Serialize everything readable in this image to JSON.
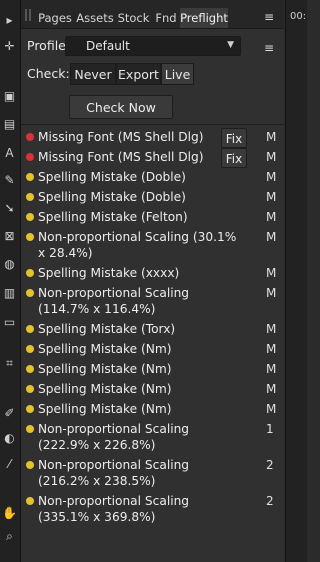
{
  "tabs": [
    "Pages",
    "Assets",
    "Stock",
    "Fnd",
    "Preflight"
  ],
  "active_tab": "Preflight",
  "right_edge_text": "00:",
  "profile": {
    "label": "Profile:",
    "value": "Default"
  },
  "check": {
    "label": "Check:",
    "options": [
      "Never",
      "Export",
      "Live"
    ],
    "selected": "Live"
  },
  "check_now_label": "Check Now",
  "fix_label": "Fix",
  "colors": {
    "error": "#d9313a",
    "warning": "#e6c22b"
  },
  "issues": [
    {
      "severity": "error",
      "text": "Missing Font (MS Shell Dlg)",
      "fix": true,
      "col": "M"
    },
    {
      "severity": "error",
      "text": "Missing Font (MS Shell Dlg)",
      "fix": true,
      "col": "M"
    },
    {
      "severity": "warning",
      "text": "Spelling Mistake (Doble)",
      "fix": false,
      "col": "M"
    },
    {
      "severity": "warning",
      "text": "Spelling Mistake (Doble)",
      "fix": false,
      "col": "M"
    },
    {
      "severity": "warning",
      "text": "Spelling Mistake (Felton)",
      "fix": false,
      "col": "M"
    },
    {
      "severity": "warning",
      "text": "Non-proportional Scaling (30.1% x 28.4%)",
      "fix": false,
      "col": "M"
    },
    {
      "severity": "warning",
      "text": "Spelling Mistake (xxxx)",
      "fix": false,
      "col": "M"
    },
    {
      "severity": "warning",
      "text": "Non-proportional Scaling (114.7% x 116.4%)",
      "fix": false,
      "col": "M"
    },
    {
      "severity": "warning",
      "text": "Spelling Mistake (Torx)",
      "fix": false,
      "col": "M"
    },
    {
      "severity": "warning",
      "text": "Spelling Mistake (Nm)",
      "fix": false,
      "col": "M"
    },
    {
      "severity": "warning",
      "text": "Spelling Mistake (Nm)",
      "fix": false,
      "col": "M"
    },
    {
      "severity": "warning",
      "text": "Spelling Mistake (Nm)",
      "fix": false,
      "col": "M"
    },
    {
      "severity": "warning",
      "text": "Spelling Mistake (Nm)",
      "fix": false,
      "col": "M"
    },
    {
      "severity": "warning",
      "text": "Non-proportional Scaling (222.9% x 226.8%)",
      "fix": false,
      "col": "1"
    },
    {
      "severity": "warning",
      "text": "Non-proportional Scaling (216.2% x 238.5%)",
      "fix": false,
      "col": "2"
    },
    {
      "severity": "warning",
      "text": "Non-proportional Scaling (335.1% x 369.8%)",
      "fix": false,
      "col": "2"
    }
  ]
}
